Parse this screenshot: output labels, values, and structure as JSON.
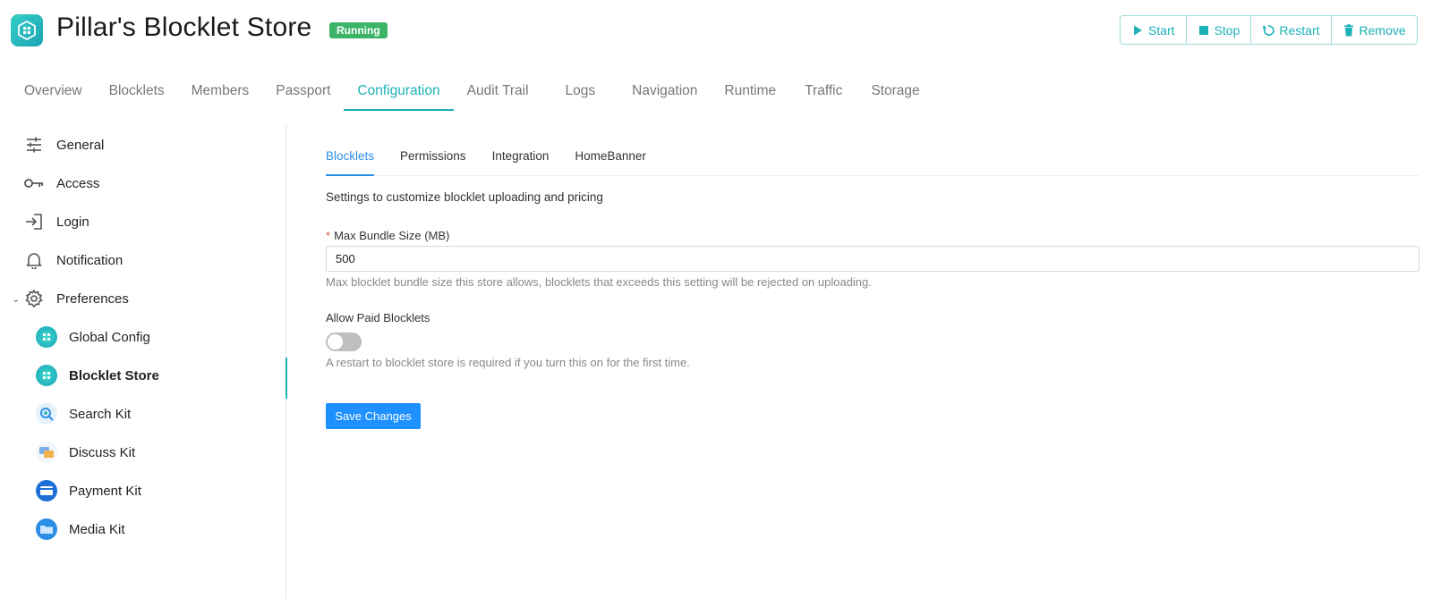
{
  "header": {
    "title": "Pillar's Blocklet Store",
    "status": "Running",
    "actions": [
      {
        "label": "Start",
        "icon": "play-icon"
      },
      {
        "label": "Stop",
        "icon": "stop-icon"
      },
      {
        "label": "Restart",
        "icon": "restart-icon"
      },
      {
        "label": "Remove",
        "icon": "trash-icon"
      }
    ]
  },
  "tabs": [
    {
      "label": "Overview"
    },
    {
      "label": "Blocklets"
    },
    {
      "label": "Members"
    },
    {
      "label": "Passport"
    },
    {
      "label": "Configuration",
      "active": true
    },
    {
      "label": "Audit Trail"
    },
    {
      "label": "Logs"
    },
    {
      "label": "Navigation"
    },
    {
      "label": "Runtime"
    },
    {
      "label": "Traffic"
    },
    {
      "label": "Storage"
    }
  ],
  "sidebar": {
    "items": [
      {
        "label": "General",
        "icon": "sliders-icon"
      },
      {
        "label": "Access",
        "icon": "key-icon"
      },
      {
        "label": "Login",
        "icon": "login-icon"
      },
      {
        "label": "Notification",
        "icon": "bell-icon"
      },
      {
        "label": "Preferences",
        "icon": "gear-icon",
        "expanded": true
      }
    ],
    "children": [
      {
        "label": "Global Config",
        "icon": "global-config-icon"
      },
      {
        "label": "Blocklet Store",
        "icon": "blocklet-store-icon",
        "active": true
      },
      {
        "label": "Search Kit",
        "icon": "search-kit-icon"
      },
      {
        "label": "Discuss Kit",
        "icon": "discuss-kit-icon"
      },
      {
        "label": "Payment Kit",
        "icon": "payment-kit-icon"
      },
      {
        "label": "Media Kit",
        "icon": "media-kit-icon"
      }
    ]
  },
  "content": {
    "subtabs": [
      {
        "label": "Blocklets",
        "active": true
      },
      {
        "label": "Permissions"
      },
      {
        "label": "Integration"
      },
      {
        "label": "HomeBanner"
      }
    ],
    "description": "Settings to customize blocklet uploading and pricing",
    "max_bundle": {
      "required_mark": "*",
      "label": "Max Bundle Size (MB)",
      "value": "500",
      "help": "Max blocklet bundle size this store allows, blocklets that exceeds this setting will be rejected on uploading."
    },
    "paid": {
      "label": "Allow Paid Blocklets",
      "enabled": false,
      "help": "A restart to blocklet store is required if you turn this on for the first time."
    },
    "save_label": "Save Changes"
  },
  "colors": {
    "accent": "#1cb1b8",
    "status_running": "#3bb467",
    "primary_button": "#1e90ff",
    "subtab_active": "#2b8ee6"
  }
}
